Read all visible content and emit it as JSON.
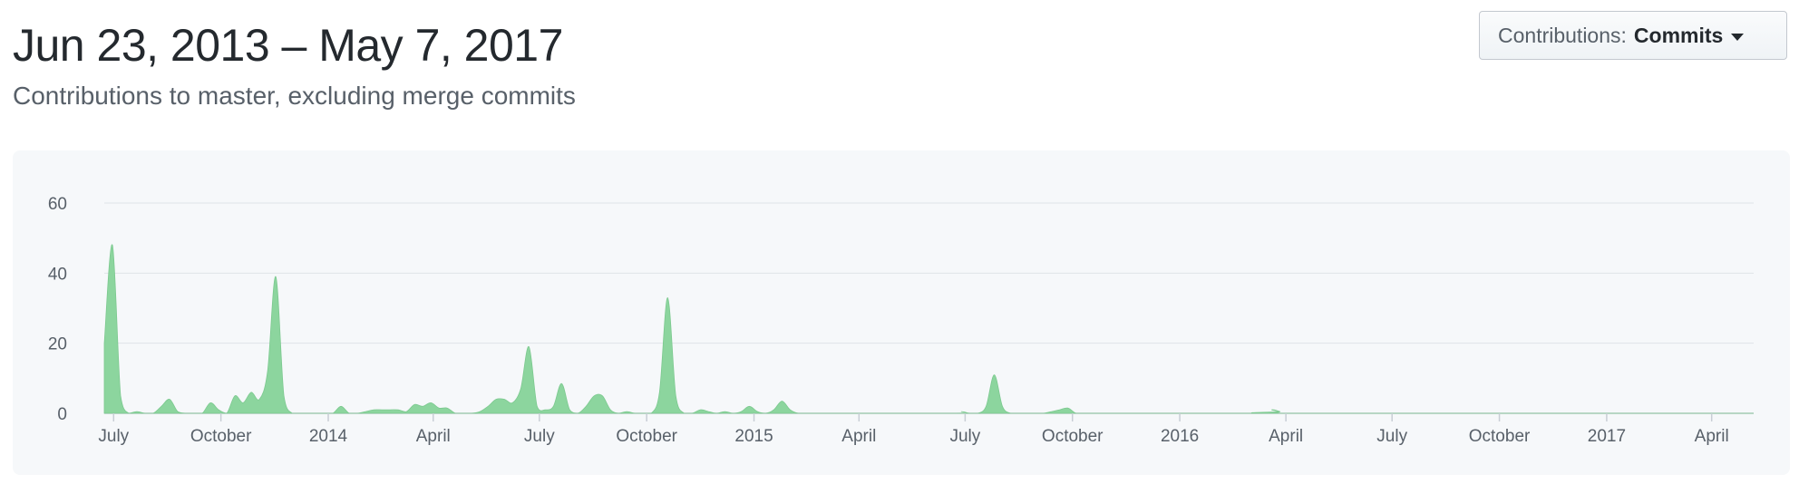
{
  "header": {
    "date_range": "Jun 23, 2013 – May 7, 2017",
    "subtitle": "Contributions to master, excluding merge commits"
  },
  "controls": {
    "contributions_label": "Contributions:",
    "contributions_value": "Commits"
  },
  "chart_data": {
    "type": "area",
    "title": "",
    "xlabel": "",
    "ylabel": "",
    "xlim": [
      "2013-06-23",
      "2017-05-07"
    ],
    "ylim": [
      0,
      60
    ],
    "yticks": [
      0,
      20,
      40,
      60
    ],
    "xticks": [
      {
        "date": "2013-07-01",
        "label": "July"
      },
      {
        "date": "2013-10-01",
        "label": "October"
      },
      {
        "date": "2014-01-01",
        "label": "2014"
      },
      {
        "date": "2014-04-01",
        "label": "April"
      },
      {
        "date": "2014-07-01",
        "label": "July"
      },
      {
        "date": "2014-10-01",
        "label": "October"
      },
      {
        "date": "2015-01-01",
        "label": "2015"
      },
      {
        "date": "2015-04-01",
        "label": "April"
      },
      {
        "date": "2015-07-01",
        "label": "July"
      },
      {
        "date": "2015-10-01",
        "label": "October"
      },
      {
        "date": "2016-01-01",
        "label": "2016"
      },
      {
        "date": "2016-04-01",
        "label": "April"
      },
      {
        "date": "2016-07-01",
        "label": "July"
      },
      {
        "date": "2016-10-01",
        "label": "October"
      },
      {
        "date": "2017-01-01",
        "label": "2017"
      },
      {
        "date": "2017-04-01",
        "label": "April"
      }
    ],
    "grid": true,
    "color": "#8cd59e",
    "series": [
      {
        "values": [
          [
            "2013-06-23",
            20
          ],
          [
            "2013-06-30",
            48
          ],
          [
            "2013-07-07",
            5
          ],
          [
            "2013-07-14",
            0
          ],
          [
            "2013-07-21",
            0.5
          ],
          [
            "2013-07-28",
            0
          ],
          [
            "2013-08-04",
            0
          ],
          [
            "2013-08-11",
            2
          ],
          [
            "2013-08-18",
            4
          ],
          [
            "2013-08-25",
            0.5
          ],
          [
            "2013-09-01",
            0
          ],
          [
            "2013-09-08",
            0
          ],
          [
            "2013-09-15",
            0
          ],
          [
            "2013-09-22",
            3
          ],
          [
            "2013-09-29",
            1
          ],
          [
            "2013-10-06",
            0
          ],
          [
            "2013-10-13",
            5
          ],
          [
            "2013-10-20",
            3
          ],
          [
            "2013-10-27",
            6
          ],
          [
            "2013-11-03",
            4
          ],
          [
            "2013-11-10",
            12
          ],
          [
            "2013-11-17",
            39
          ],
          [
            "2013-11-24",
            5
          ],
          [
            "2013-12-01",
            0
          ],
          [
            "2013-12-08",
            0
          ],
          [
            "2013-12-15",
            0
          ],
          [
            "2013-12-22",
            0
          ],
          [
            "2013-12-29",
            0
          ],
          [
            "2014-01-05",
            0
          ],
          [
            "2014-01-12",
            2
          ],
          [
            "2014-01-19",
            0
          ],
          [
            "2014-01-26",
            0
          ],
          [
            "2014-02-02",
            0.5
          ],
          [
            "2014-02-09",
            1
          ],
          [
            "2014-02-16",
            1
          ],
          [
            "2014-02-23",
            1
          ],
          [
            "2014-03-02",
            1
          ],
          [
            "2014-03-09",
            0.5
          ],
          [
            "2014-03-16",
            2.5
          ],
          [
            "2014-03-23",
            2
          ],
          [
            "2014-03-30",
            3
          ],
          [
            "2014-04-06",
            1.5
          ],
          [
            "2014-04-13",
            1.5
          ],
          [
            "2014-04-20",
            0
          ],
          [
            "2014-04-27",
            0
          ],
          [
            "2014-05-04",
            0
          ],
          [
            "2014-05-11",
            0.5
          ],
          [
            "2014-05-18",
            2
          ],
          [
            "2014-05-25",
            4
          ],
          [
            "2014-06-01",
            4
          ],
          [
            "2014-06-08",
            3
          ],
          [
            "2014-06-15",
            7
          ],
          [
            "2014-06-22",
            19
          ],
          [
            "2014-06-29",
            2
          ],
          [
            "2014-07-06",
            1
          ],
          [
            "2014-07-13",
            2
          ],
          [
            "2014-07-20",
            8.5
          ],
          [
            "2014-07-27",
            1
          ],
          [
            "2014-08-03",
            0
          ],
          [
            "2014-08-10",
            2
          ],
          [
            "2014-08-17",
            5
          ],
          [
            "2014-08-24",
            5
          ],
          [
            "2014-08-31",
            1
          ],
          [
            "2014-09-07",
            0
          ],
          [
            "2014-09-14",
            0.5
          ],
          [
            "2014-09-21",
            0
          ],
          [
            "2014-09-28",
            0
          ],
          [
            "2014-10-05",
            0
          ],
          [
            "2014-10-12",
            6
          ],
          [
            "2014-10-19",
            33
          ],
          [
            "2014-10-26",
            5
          ],
          [
            "2014-11-02",
            0
          ],
          [
            "2014-11-09",
            0
          ],
          [
            "2014-11-16",
            1
          ],
          [
            "2014-11-23",
            0.5
          ],
          [
            "2014-11-30",
            0
          ],
          [
            "2014-12-07",
            0.5
          ],
          [
            "2014-12-14",
            0
          ],
          [
            "2014-12-21",
            0.5
          ],
          [
            "2014-12-28",
            2
          ],
          [
            "2015-01-04",
            0.5
          ],
          [
            "2015-01-11",
            0
          ],
          [
            "2015-01-18",
            1
          ],
          [
            "2015-01-25",
            3.5
          ],
          [
            "2015-02-01",
            1
          ],
          [
            "2015-02-08",
            0
          ],
          [
            "2015-02-15",
            0
          ],
          [
            "2015-02-22",
            0
          ],
          [
            "2015-06-21",
            0
          ],
          [
            "2015-06-28",
            0.5
          ],
          [
            "2015-07-05",
            0
          ],
          [
            "2015-07-12",
            0
          ],
          [
            "2015-07-19",
            2
          ],
          [
            "2015-07-26",
            11
          ],
          [
            "2015-08-02",
            2
          ],
          [
            "2015-08-09",
            0
          ],
          [
            "2015-08-16",
            0
          ],
          [
            "2015-08-23",
            0
          ],
          [
            "2015-08-30",
            0
          ],
          [
            "2015-09-06",
            0
          ],
          [
            "2015-09-13",
            0.5
          ],
          [
            "2015-09-20",
            1
          ],
          [
            "2015-09-27",
            1.5
          ],
          [
            "2015-10-04",
            0
          ],
          [
            "2015-10-11",
            0
          ],
          [
            "2016-03-13",
            0
          ],
          [
            "2016-03-20",
            1
          ],
          [
            "2016-03-27",
            0.5
          ],
          [
            "2016-04-03",
            0
          ],
          [
            "2017-05-07",
            0
          ]
        ]
      }
    ]
  }
}
